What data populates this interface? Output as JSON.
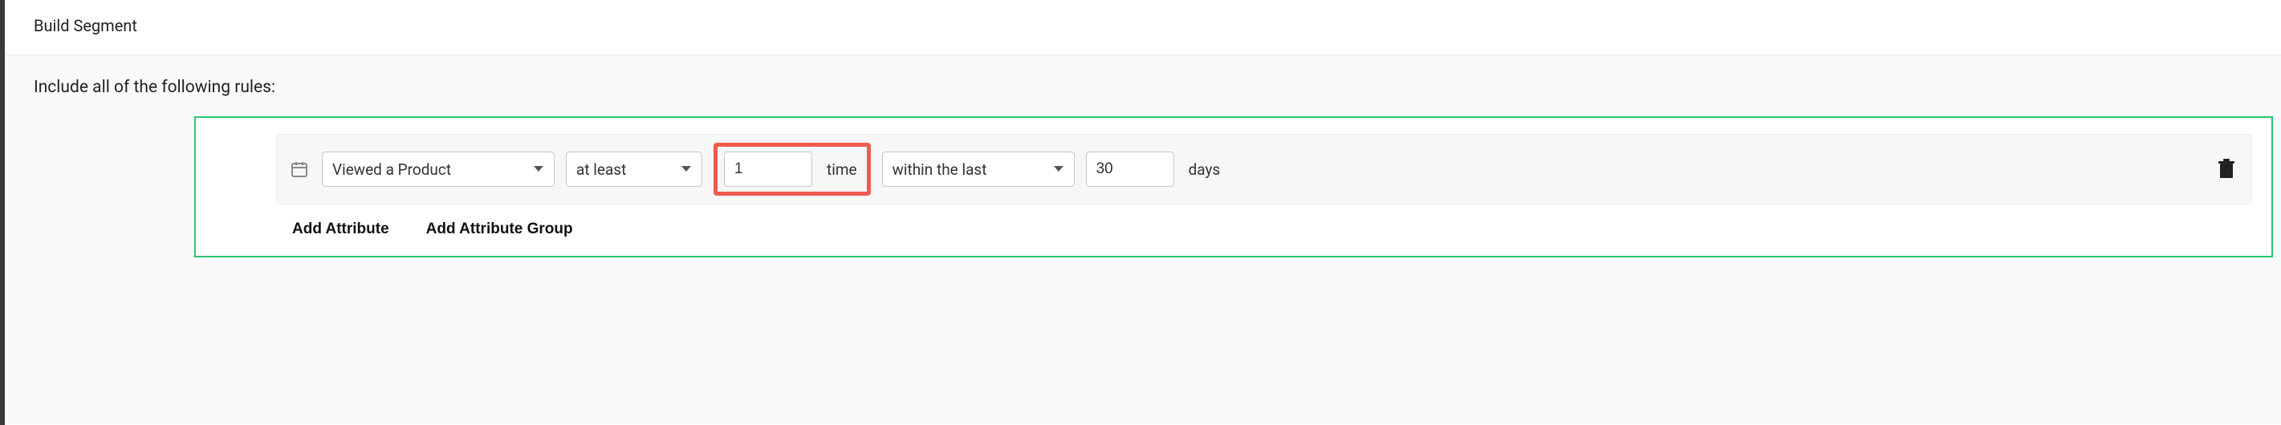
{
  "header": {
    "title": "Build Segment"
  },
  "body": {
    "rules_intro": "Include all of the following rules:"
  },
  "rule": {
    "event": "Viewed a Product",
    "frequency_op": "at least",
    "count_value": "1",
    "count_unit": "time",
    "window_op": "within the last",
    "window_value": "30",
    "window_unit": "days"
  },
  "actions": {
    "add_attribute": "Add Attribute",
    "add_attribute_group": "Add Attribute Group"
  },
  "icons": {
    "calendar": "calendar-icon",
    "caret": "chevron-down-icon",
    "trash": "trash-icon"
  }
}
